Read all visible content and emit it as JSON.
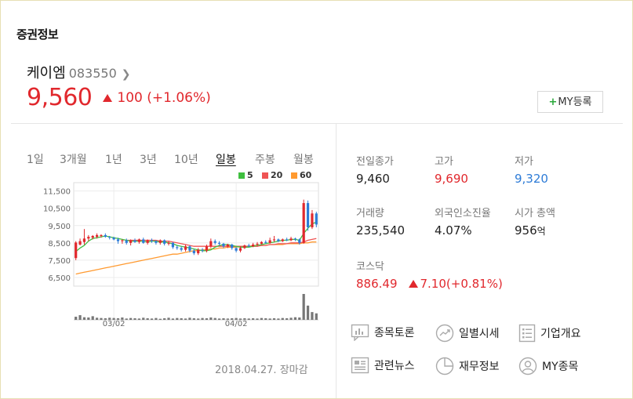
{
  "section_title": "증권정보",
  "stock": {
    "name": "케이엠",
    "code": "083550",
    "price": "9,560",
    "change": "100 (+1.06%)",
    "my_button": "MY등록"
  },
  "tabs": [
    {
      "label": "1일"
    },
    {
      "label": "3개월"
    },
    {
      "label": "1년"
    },
    {
      "label": "3년"
    },
    {
      "label": "10년"
    },
    {
      "label": "일봉"
    },
    {
      "label": "주봉"
    },
    {
      "label": "월봉"
    }
  ],
  "active_tab": "일봉",
  "legend": [
    {
      "label": "5",
      "color": "#3fbf3f"
    },
    {
      "label": "20",
      "color": "#ef5454"
    },
    {
      "label": "60",
      "color": "#ff9a30"
    }
  ],
  "colors": {
    "up": "#e1282d",
    "down": "#2e7cd7",
    "accent": "#2aa83a"
  },
  "chart_data": {
    "type": "candlestick",
    "y_ticks": [
      "11,500",
      "10,500",
      "9,500",
      "8,500",
      "7,500",
      "6,500"
    ],
    "ylim": [
      6000,
      11800
    ],
    "x_ticks": [
      "03/02",
      "04/02"
    ],
    "grid": true,
    "candles": [
      [
        7620,
        8520,
        7500,
        8600
      ],
      [
        8400,
        8600,
        8350,
        8750
      ],
      [
        8550,
        8750,
        8400,
        9300
      ],
      [
        8750,
        8850,
        8600,
        8950
      ],
      [
        8800,
        8900,
        8700,
        8950
      ],
      [
        8850,
        8950,
        8750,
        9050
      ],
      [
        8900,
        8950,
        8800,
        9000
      ],
      [
        8950,
        8850,
        8800,
        9050
      ],
      [
        8850,
        8800,
        8700,
        8900
      ],
      [
        8800,
        8700,
        8650,
        8850
      ],
      [
        8700,
        8600,
        8450,
        8800
      ],
      [
        8600,
        8650,
        8450,
        8700
      ],
      [
        8650,
        8500,
        8400,
        8750
      ],
      [
        8500,
        8650,
        8350,
        8700
      ],
      [
        8650,
        8550,
        8500,
        8750
      ],
      [
        8550,
        8700,
        8450,
        8750
      ],
      [
        8700,
        8500,
        8450,
        8800
      ],
      [
        8500,
        8650,
        8400,
        8700
      ],
      [
        8650,
        8600,
        8500,
        8750
      ],
      [
        8600,
        8500,
        8400,
        8650
      ],
      [
        8500,
        8650,
        8400,
        8700
      ],
      [
        8650,
        8450,
        8350,
        8700
      ],
      [
        8450,
        8500,
        8350,
        8600
      ],
      [
        8500,
        8250,
        8150,
        8550
      ],
      [
        8250,
        8200,
        8100,
        8350
      ],
      [
        8200,
        8100,
        8000,
        8300
      ],
      [
        8100,
        8300,
        8000,
        8400
      ],
      [
        8300,
        8050,
        7950,
        8350
      ],
      [
        8050,
        7900,
        7800,
        8150
      ],
      [
        7900,
        8100,
        7800,
        8200
      ],
      [
        8100,
        8050,
        7950,
        8200
      ],
      [
        8050,
        8300,
        7950,
        8400
      ],
      [
        8300,
        8600,
        8200,
        8750
      ],
      [
        8600,
        8500,
        8400,
        8700
      ],
      [
        8500,
        8450,
        8350,
        8600
      ],
      [
        8450,
        8300,
        8200,
        8500
      ],
      [
        8300,
        8400,
        8200,
        8450
      ],
      [
        8400,
        8200,
        8100,
        8450
      ],
      [
        8200,
        8050,
        7950,
        8250
      ],
      [
        8050,
        8200,
        7950,
        8300
      ],
      [
        8200,
        8350,
        8150,
        8400
      ],
      [
        8350,
        8300,
        8250,
        8450
      ],
      [
        8300,
        8400,
        8250,
        8500
      ],
      [
        8400,
        8450,
        8300,
        8550
      ],
      [
        8450,
        8550,
        8400,
        8600
      ],
      [
        8550,
        8500,
        8450,
        8650
      ],
      [
        8500,
        8650,
        8450,
        8800
      ],
      [
        8650,
        8700,
        8550,
        8900
      ],
      [
        8700,
        8600,
        8550,
        8750
      ],
      [
        8600,
        8700,
        8550,
        8750
      ],
      [
        8700,
        8650,
        8600,
        8800
      ],
      [
        8650,
        8750,
        8600,
        8850
      ],
      [
        8750,
        8700,
        8600,
        8800
      ],
      [
        8700,
        8500,
        8400,
        8750
      ],
      [
        8500,
        10800,
        8450,
        11000
      ],
      [
        10800,
        9400,
        9200,
        10950
      ],
      [
        9400,
        10200,
        9300,
        10400
      ],
      [
        10200,
        9560,
        9400,
        10300
      ]
    ],
    "ma": {
      "5": [
        8000,
        8200,
        8350,
        8600,
        8750,
        8800,
        8850,
        8900,
        8850,
        8800,
        8750,
        8700,
        8650,
        8600,
        8600,
        8600,
        8600,
        8550,
        8600,
        8600,
        8550,
        8550,
        8500,
        8450,
        8350,
        8300,
        8250,
        8200,
        8150,
        8100,
        8050,
        8050,
        8100,
        8250,
        8350,
        8400,
        8400,
        8350,
        8300,
        8250,
        8250,
        8250,
        8300,
        8350,
        8400,
        8450,
        8500,
        8550,
        8600,
        8650,
        8650,
        8700,
        8700,
        8650,
        9050,
        9350,
        9600,
        9700
      ],
      "20": [
        null,
        null,
        null,
        null,
        null,
        null,
        null,
        null,
        null,
        null,
        null,
        null,
        8650,
        8650,
        8650,
        8650,
        8650,
        8650,
        8650,
        8650,
        8600,
        8600,
        8600,
        8550,
        8500,
        8450,
        8400,
        8350,
        8300,
        8300,
        8300,
        8300,
        8300,
        8300,
        8300,
        8300,
        8300,
        8300,
        8300,
        8300,
        8300,
        8300,
        8300,
        8300,
        8350,
        8350,
        8400,
        8400,
        8450,
        8450,
        8450,
        8500,
        8500,
        8500,
        8550,
        8650,
        8700,
        8750
      ],
      "60": [
        6700,
        6750,
        6800,
        6850,
        6900,
        6950,
        7000,
        7050,
        7100,
        7150,
        7200,
        7250,
        7300,
        7350,
        7400,
        7450,
        7500,
        7550,
        7600,
        7650,
        7700,
        7750,
        7800,
        7850,
        7850,
        7900,
        7950,
        8000,
        8050,
        8050,
        8100,
        8100,
        8150,
        8150,
        8200,
        8200,
        8250,
        8250,
        8250,
        8300,
        8300,
        8300,
        8350,
        8350,
        8350,
        8350,
        8400,
        8400,
        8400,
        8400,
        8450,
        8450,
        8450,
        8450,
        8500,
        8500,
        8550,
        8550
      ]
    },
    "volume": [
      12,
      18,
      10,
      9,
      14,
      8,
      7,
      6,
      8,
      7,
      6,
      9,
      5,
      7,
      6,
      5,
      8,
      6,
      5,
      7,
      4,
      6,
      8,
      5,
      7,
      6,
      5,
      8,
      6,
      5,
      7,
      6,
      9,
      7,
      5,
      6,
      5,
      6,
      7,
      5,
      6,
      5,
      6,
      5,
      7,
      6,
      5,
      6,
      5,
      7,
      6,
      8,
      10,
      9,
      100,
      55,
      30,
      25
    ]
  },
  "closing_note": "2018.04.27. 장마감",
  "stats": {
    "prev_close": {
      "label": "전일종가",
      "value": "9,460"
    },
    "high": {
      "label": "고가",
      "value": "9,690"
    },
    "low": {
      "label": "저가",
      "value": "9,320"
    },
    "volume": {
      "label": "거래량",
      "value": "235,540"
    },
    "foreign_ratio": {
      "label": "외국인소진율",
      "value": "4.07%"
    },
    "market_cap": {
      "label": "시가 총액",
      "value": "956",
      "unit": "억"
    },
    "index": {
      "label": "코스닥",
      "value": "886.49",
      "change": "7.10(+0.81%)"
    }
  },
  "links": [
    {
      "label": "종목토론",
      "icon": "discussion-icon"
    },
    {
      "label": "일별시세",
      "icon": "trend-icon"
    },
    {
      "label": "기업개요",
      "icon": "document-list-icon"
    },
    {
      "label": "관련뉴스",
      "icon": "news-icon"
    },
    {
      "label": "재무정보",
      "icon": "pie-chart-icon"
    },
    {
      "label": "MY종목",
      "icon": "user-icon"
    }
  ]
}
